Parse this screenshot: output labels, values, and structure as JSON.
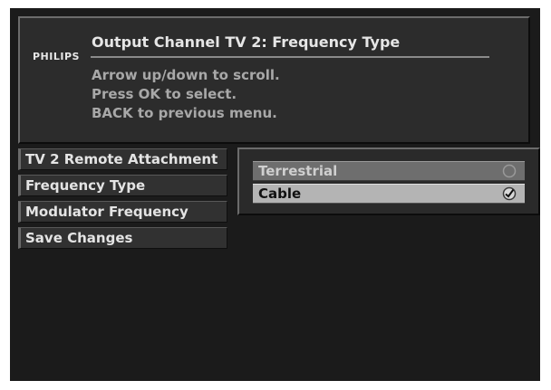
{
  "header": {
    "brand": "PHILIPS",
    "title": "Output Channel TV 2: Frequency Type",
    "help_lines": [
      "Arrow up/down to scroll.",
      "Press OK to select.",
      "BACK to previous menu."
    ]
  },
  "menu": {
    "items": [
      {
        "label": "TV 2 Remote Attachment"
      },
      {
        "label": "Frequency Type"
      },
      {
        "label": "Modulator Frequency"
      },
      {
        "label": "Save Changes"
      }
    ]
  },
  "options": {
    "items": [
      {
        "label": "Terrestrial",
        "selected": false,
        "icon": "radio-empty-icon"
      },
      {
        "label": "Cable",
        "selected": true,
        "icon": "radio-checked-icon"
      }
    ]
  }
}
